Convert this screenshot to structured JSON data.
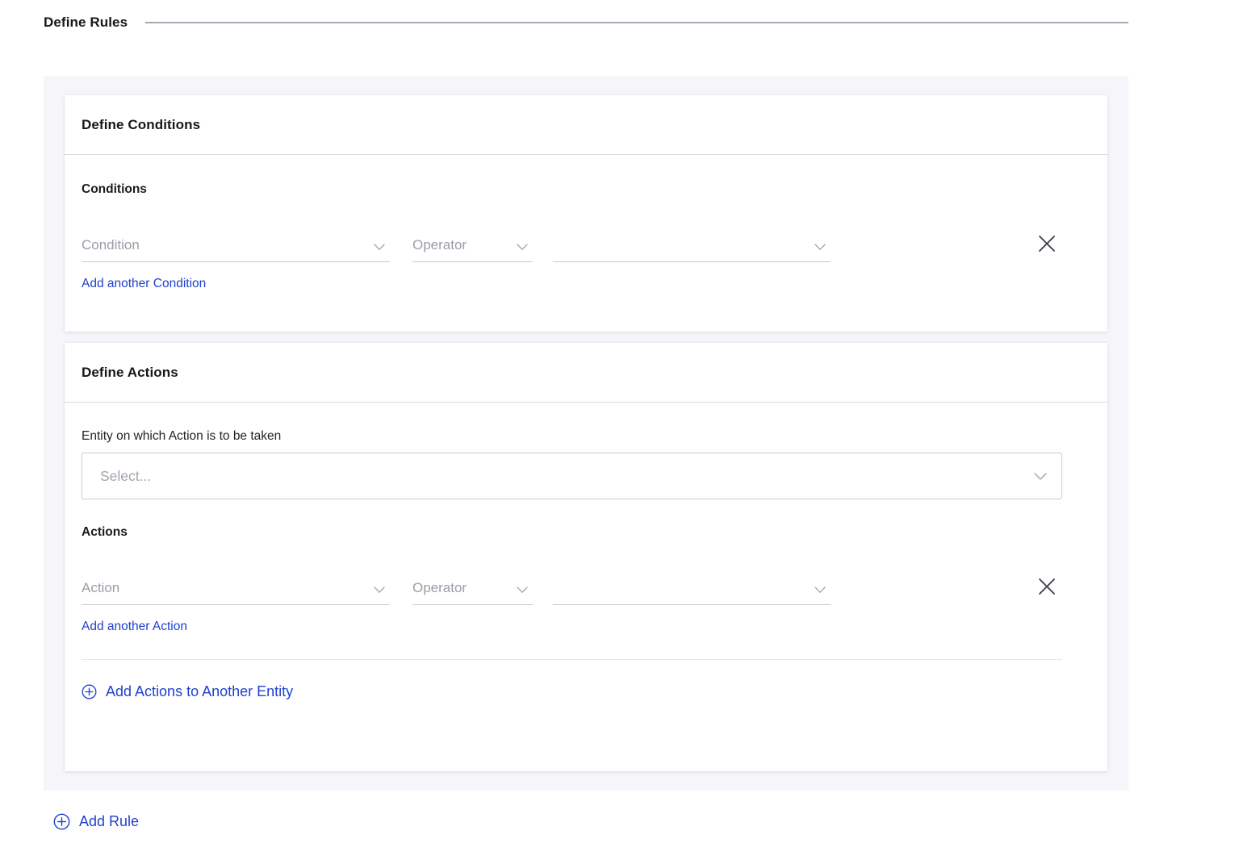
{
  "page": {
    "section_title": "Define Rules"
  },
  "conditions_card": {
    "header": "Define Conditions",
    "group_label": "Conditions",
    "row": {
      "condition_placeholder": "Condition",
      "operator_placeholder": "Operator",
      "value_placeholder": "",
      "remove_icon": "close-icon"
    },
    "add_link": "Add another Condition"
  },
  "actions_card": {
    "header": "Define Actions",
    "entity_label": "Entity on which Action is to be taken",
    "entity_select_placeholder": "Select...",
    "group_label": "Actions",
    "row": {
      "action_placeholder": "Action",
      "operator_placeholder": "Operator",
      "value_placeholder": "",
      "remove_icon": "close-icon"
    },
    "add_link": "Add another Action",
    "add_entity_label": "Add Actions to Another Entity",
    "add_entity_icon": "plus-circle-icon"
  },
  "footer": {
    "add_rule_label": "Add Rule",
    "add_rule_icon": "plus-circle-icon"
  },
  "colors": {
    "link_blue": "#2041cf",
    "panel_bg": "#f6f6fa",
    "card_bg": "#ffffff",
    "border_gray": "#d9d9e0",
    "placeholder_gray": "#9d9da8",
    "rule_line": "#a7a7b4"
  }
}
